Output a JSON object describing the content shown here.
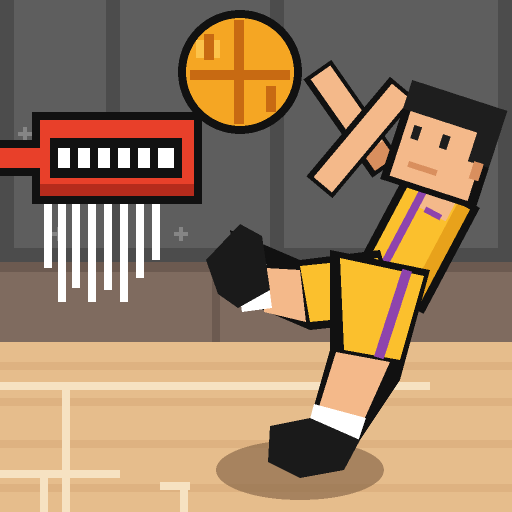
{
  "scene": {
    "type": "pixel-art basketball game artwork",
    "elements": [
      "basketball",
      "hoop",
      "net",
      "player",
      "court"
    ]
  },
  "colors": {
    "wall": "#666666",
    "wall_panel": "#5e5e5e",
    "wall_border": "#4c4c4c",
    "wall_stud": "#858585",
    "baseboard": "#7f6b5f",
    "baseboard_dark": "#6c5a50",
    "floor": "#e6bd8c",
    "floor_alt": "#deb281",
    "court_line": "#f6e2c2",
    "shadow": "#8c6b4b",
    "ball": "#f5a623",
    "ball_light": "#fcc34b",
    "ball_line": "#c86a12",
    "rim": "#e8402a",
    "rim_dark": "#b52b1c",
    "net": "#ffffff",
    "skin": "#f4b98a",
    "skin_shade": "#d98f5e",
    "hair": "#1e1e1e",
    "jersey": "#fbc02d",
    "jersey_shade": "#e8a21b",
    "stripe": "#8e44ad",
    "sock": "#ffffff",
    "shoe": "#1a1a1a",
    "outline": "#111111"
  },
  "icons": [
    "basketball-icon",
    "hoop-icon",
    "player-icon"
  ]
}
